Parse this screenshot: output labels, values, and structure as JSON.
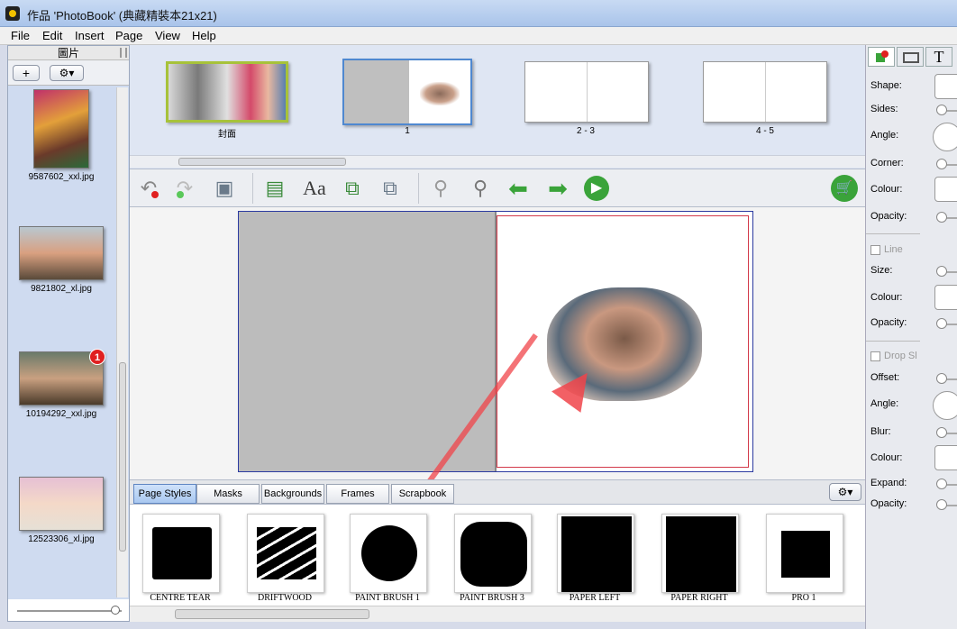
{
  "window": {
    "title": "作品 'PhotoBook' (典藏精裝本21x21)"
  },
  "menu": [
    "File",
    "Edit",
    "Insert",
    "Page",
    "View",
    "Help"
  ],
  "left_panel": {
    "header": "圖片",
    "add_label": "+",
    "settings_label": "⚙▾",
    "photos": [
      {
        "name": "9587602_xxl.jpg"
      },
      {
        "name": "9821802_xl.jpg"
      },
      {
        "name": "10194292_xxl.jpg",
        "badge": "1"
      },
      {
        "name": "12523306_xl.jpg"
      }
    ]
  },
  "pages": [
    {
      "label": "封面"
    },
    {
      "label": "1"
    },
    {
      "label": "2 - 3"
    },
    {
      "label": "4 - 5"
    }
  ],
  "toolbar": {
    "icons": [
      "undo-icon",
      "redo-icon",
      "save-icon",
      "add-photo-icon",
      "add-text-icon",
      "add-page-icon",
      "copy-page-icon",
      "zoom-out-icon",
      "zoom-in-icon",
      "previous-page-icon",
      "next-page-icon",
      "play-icon",
      "cart-icon"
    ]
  },
  "tabs": [
    {
      "label": "Page Styles",
      "active": true
    },
    {
      "label": "Masks"
    },
    {
      "label": "Backgrounds"
    },
    {
      "label": "Frames"
    },
    {
      "label": "Scrapbook"
    }
  ],
  "styles": [
    {
      "label": "CENTRE TEAR"
    },
    {
      "label": "DRIFTWOOD"
    },
    {
      "label": "PAINT BRUSH 1"
    },
    {
      "label": "PAINT BRUSH 3"
    },
    {
      "label": "PAPER LEFT"
    },
    {
      "label": "PAPER RIGHT"
    },
    {
      "label": "PRO 1"
    }
  ],
  "right_panel": {
    "tab_text_label": "T",
    "shape": {
      "shape": "Shape:",
      "sides": "Sides:",
      "angle": "Angle:",
      "corner": "Corner:",
      "colour": "Colour:",
      "opacity": "Opacity:"
    },
    "line": {
      "title": "Line",
      "size": "Size:",
      "colour": "Colour:",
      "opacity": "Opacity:"
    },
    "shadow": {
      "title": "Drop Sl",
      "offset": "Offset:",
      "angle": "Angle:",
      "blur": "Blur:",
      "colour": "Colour:",
      "expand": "Expand:",
      "opacity": "Opacity:"
    }
  },
  "colors": {
    "accent": "#2f6fc2",
    "green": "#3aa33a",
    "badge": "#e02020"
  }
}
